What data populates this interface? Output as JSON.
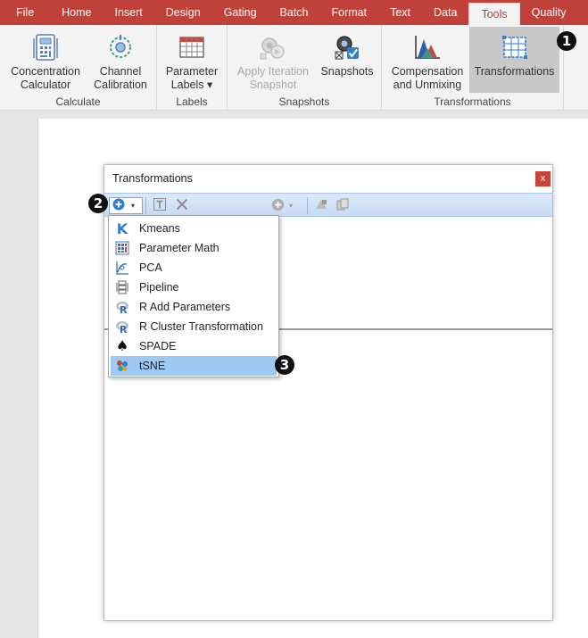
{
  "menu": {
    "items": [
      "File",
      "Home",
      "Insert",
      "Design",
      "Gating",
      "Batch",
      "Format",
      "Text",
      "Data",
      "Tools",
      "Quality"
    ],
    "active": "Tools"
  },
  "ribbon": {
    "groups": {
      "calculate": {
        "label": "Calculate",
        "concentration": [
          "Concentration",
          "Calculator"
        ],
        "channel": [
          "Channel",
          "Calibration"
        ]
      },
      "labels": {
        "label": "Labels",
        "parameter": [
          "Parameter",
          "Labels ▾"
        ]
      },
      "snapshots": {
        "label": "Snapshots",
        "apply": [
          "Apply Iteration",
          "Snapshot"
        ],
        "snapshots": "Snapshots"
      },
      "transformations": {
        "label": "Transformations",
        "compensation": [
          "Compensation",
          "and Unmixing"
        ],
        "transformations": "Transformations"
      }
    }
  },
  "dialog": {
    "title": "Transformations",
    "close": "x"
  },
  "dropdown": {
    "items": [
      {
        "label": "Kmeans",
        "icon": "kmeans-icon"
      },
      {
        "label": "Parameter Math",
        "icon": "parameter-math-icon"
      },
      {
        "label": "PCA",
        "icon": "pca-icon"
      },
      {
        "label": "Pipeline",
        "icon": "pipeline-icon"
      },
      {
        "label": "R Add Parameters",
        "icon": "r-icon"
      },
      {
        "label": "R Cluster Transformation",
        "icon": "r-icon"
      },
      {
        "label": "SPADE",
        "icon": "spade-icon"
      },
      {
        "label": "tSNE",
        "icon": "tsne-icon"
      }
    ],
    "highlighted": "tSNE"
  },
  "badges": {
    "one": "1",
    "two": "2",
    "three": "3"
  },
  "colors": {
    "accent": "#c0413a",
    "highlight": "#9dc9f3",
    "toolbar": "#c7dbf4"
  }
}
